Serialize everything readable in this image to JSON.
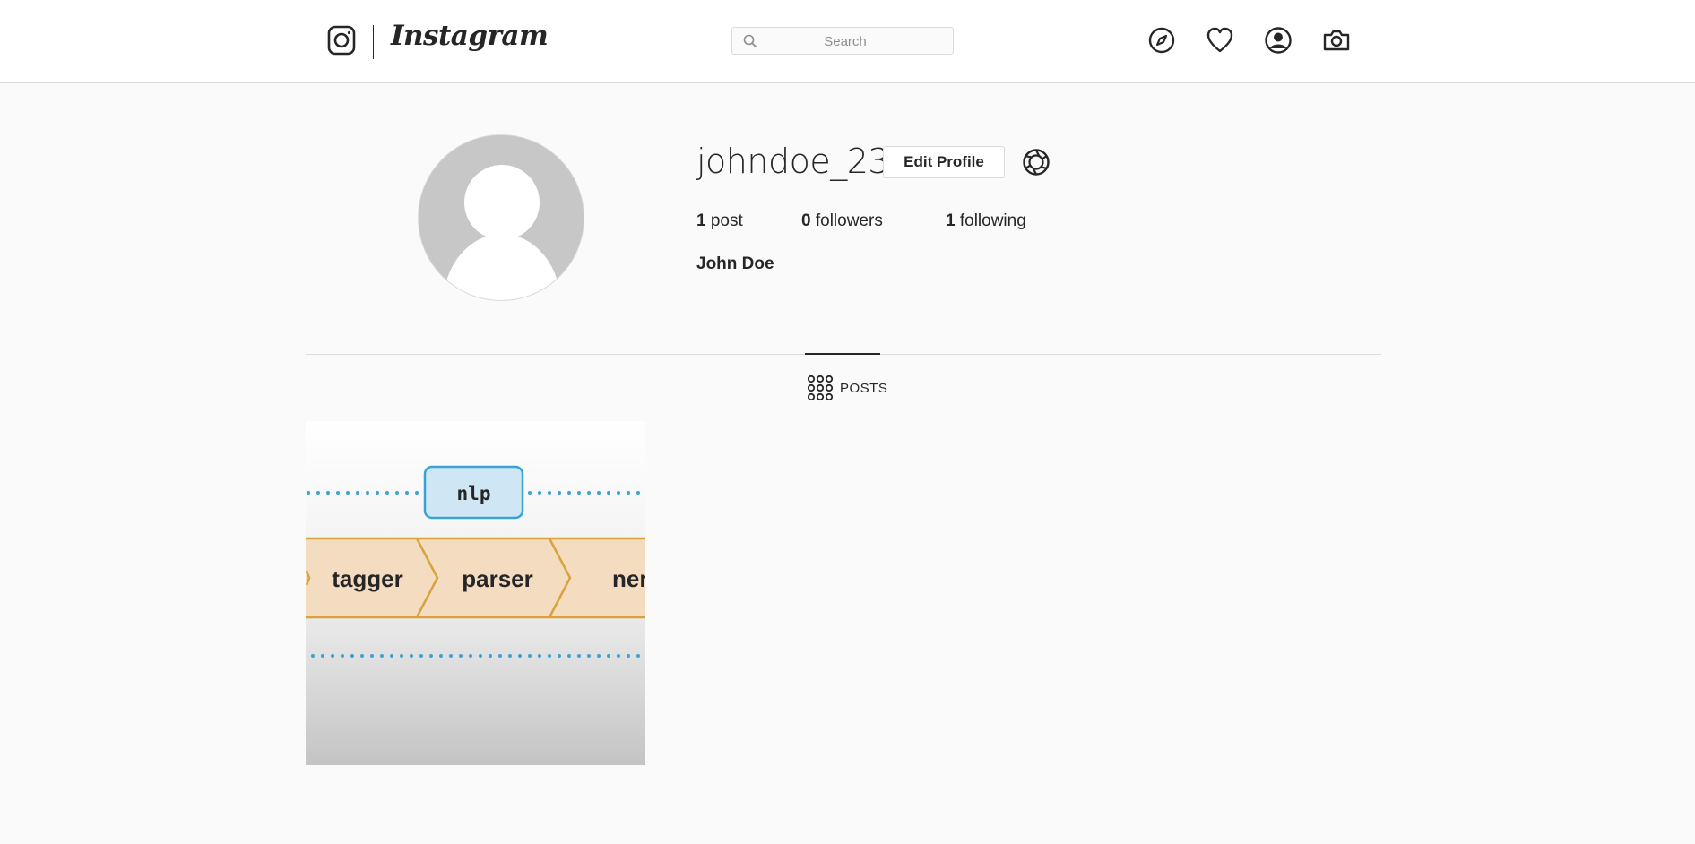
{
  "app": {
    "brand": "Instagram"
  },
  "header": {
    "search_placeholder": "Search",
    "icons": [
      "instagram-logo-icon",
      "explore-icon",
      "heart-icon",
      "profile-icon",
      "camera-icon"
    ]
  },
  "profile": {
    "username": "johndoe_23",
    "edit_label": "Edit Profile",
    "full_name": "John Doe",
    "stats": {
      "posts": {
        "count": "1",
        "label": "post"
      },
      "followers": {
        "count": "0",
        "label": "followers"
      },
      "following": {
        "count": "1",
        "label": "following"
      }
    }
  },
  "tabs": {
    "posts_label": "POSTS"
  },
  "posts": [
    {
      "node_label": "nlp",
      "pipeline": [
        "tagger",
        "parser",
        "ner"
      ]
    }
  ],
  "colors": {
    "accent_blue": "#39a3d4",
    "pipeline_fill": "#f3dcc0",
    "pipeline_border": "#d9a23a",
    "text": "#262626",
    "border": "#dbdbdb"
  }
}
